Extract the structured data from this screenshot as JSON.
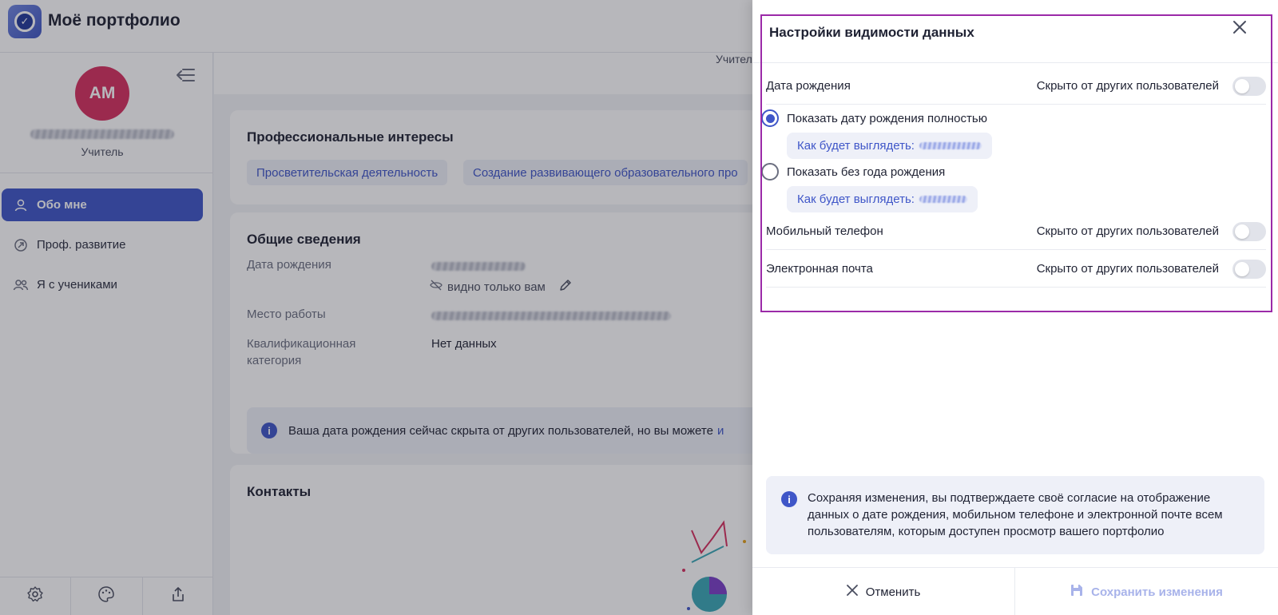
{
  "app": {
    "title": "Моё портфолио"
  },
  "sidebar": {
    "avatar_initials": "АМ",
    "user_role": "Учитель",
    "items": [
      {
        "label": "Обо мне",
        "icon": "user-icon",
        "active": true
      },
      {
        "label": "Проф. развитие",
        "icon": "growth-icon",
        "active": false
      },
      {
        "label": "Я с учениками",
        "icon": "users-icon",
        "active": false
      }
    ],
    "bottom_icons": [
      "settings-icon",
      "palette-icon",
      "share-icon"
    ]
  },
  "main": {
    "subheader_text": "Учител",
    "interests": {
      "title": "Профессиональные интересы",
      "chips": [
        "Просветительская деятельность",
        "Создание развивающего образовательного про"
      ]
    },
    "general": {
      "title": "Общие сведения",
      "birth_label": "Дата рождения",
      "visible_note": "видно только вам",
      "workplace_label": "Место работы",
      "qualification_label_line1": "Квалификационная",
      "qualification_label_line2": "категория",
      "qualification_value": "Нет данных",
      "info_text": "Ваша дата рождения сейчас скрыта от других пользователей, но вы можете",
      "info_link": "и"
    },
    "contacts": {
      "title": "Контакты"
    }
  },
  "drawer": {
    "title": "Настройки видимости данных",
    "rows": {
      "birth": {
        "label": "Дата рождения",
        "status": "Скрыто от других пользователей",
        "enabled": false
      },
      "phone": {
        "label": "Мобильный телефон",
        "status": "Скрыто от других пользователей",
        "enabled": false
      },
      "email": {
        "label": "Электронная почта",
        "status": "Скрыто от других пользователей",
        "enabled": false
      }
    },
    "birth_options": [
      {
        "label": "Показать дату рождения полностью",
        "preview": "Как будет выглядеть:",
        "selected": true
      },
      {
        "label": "Показать без года рождения",
        "preview": "Как будет выглядеть:",
        "selected": false
      }
    ],
    "consent_text": "Сохраняя изменения, вы подтверждаете своё согласие на отображение данных о дате рождения, мобильном телефоне и электронной почте всем пользователям, которым доступен просмотр вашего портфолио",
    "cancel_label": "Отменить",
    "save_label": "Сохранить изменения"
  },
  "colors": {
    "accent": "#3f56c8",
    "avatar": "#d6305f",
    "highlight": "#9b2aa8"
  }
}
